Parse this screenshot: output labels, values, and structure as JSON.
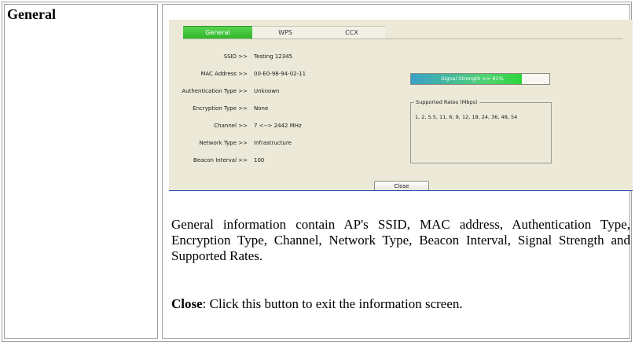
{
  "section": {
    "title": "General"
  },
  "dialog": {
    "tabs": [
      {
        "label": "General",
        "active": true
      },
      {
        "label": "WPS",
        "active": false
      },
      {
        "label": "CCX",
        "active": false
      }
    ],
    "fields": [
      {
        "label": "SSID >>",
        "value": "Testing 12345"
      },
      {
        "label": "MAC Address >>",
        "value": "00-E0-98-94-02-11"
      },
      {
        "label": "Authentication Type >>",
        "value": "Unknown"
      },
      {
        "label": "Encryption Type >>",
        "value": "None"
      },
      {
        "label": "Channel >>",
        "value": "7 <--> 2442 MHz"
      },
      {
        "label": "Network Type >>",
        "value": "Infrastructure"
      },
      {
        "label": "Beacon Interval >>",
        "value": "100"
      }
    ],
    "signal": {
      "text": "Signal Strength >> 91%",
      "percent": 91
    },
    "rates": {
      "legend": "Supported Rates (Mbps)",
      "values": "1, 2, 5.5, 11, 6, 9, 12, 18, 24, 36, 48, 54"
    },
    "close_label": "Close"
  },
  "description": {
    "paragraph": "General information contain AP's SSID, MAC address, Authentication Type, Encryption Type, Channel, Network Type, Beacon Interval, Signal Strength and Supported Rates.",
    "close_term": "Close",
    "close_text": ": Click this button to exit the information screen."
  },
  "colors": {
    "active_tab": "#2fb42a",
    "dialog_bg": "#ece9d8",
    "accent_line": "#2b55b0"
  }
}
